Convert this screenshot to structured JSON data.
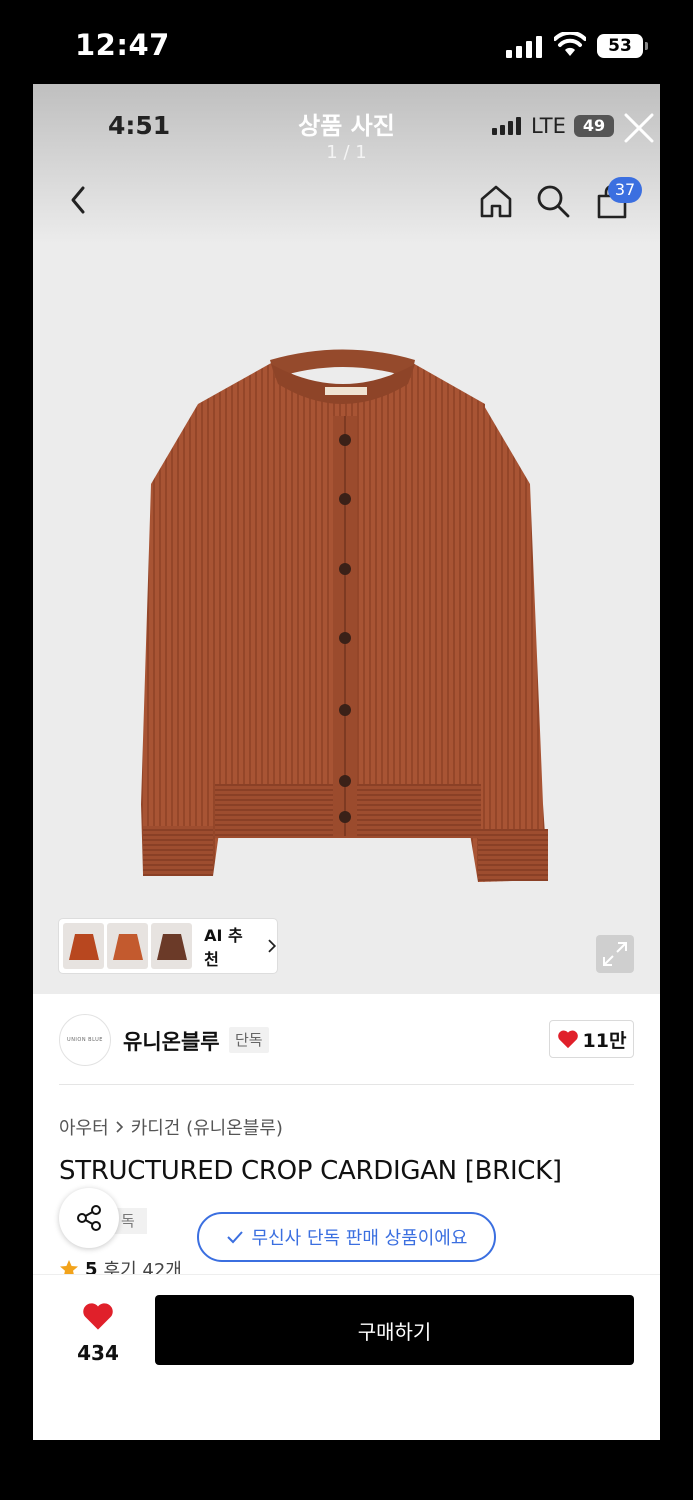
{
  "os_status": {
    "time": "12:47",
    "battery": "53"
  },
  "viewer": {
    "title": "상품 사진",
    "counter": "1 / 1"
  },
  "inner_status": {
    "time": "4:51",
    "network": "LTE",
    "battery": "49"
  },
  "nav": {
    "cart_count": "37"
  },
  "ai_recommend": {
    "label": "AI 추천"
  },
  "brand": {
    "logo_text": "UNION BLUE",
    "name": "유니온블루",
    "exclusive_tag": "단독",
    "like_count": "11만"
  },
  "breadcrumb": {
    "category": "아우터",
    "subcategory": "카디건 (유니온블루)"
  },
  "product": {
    "title": "STRUCTURED CROP CARDIGAN [BRICK]",
    "tag_partial": "독"
  },
  "exclusive_notice": "무신사 단독 판매 상품이에요",
  "rating": {
    "score": "5",
    "reviews": "후기 42개"
  },
  "bottom_bar": {
    "wish_count": "434",
    "buy_label": "구매하기"
  },
  "colors": {
    "accent_blue": "#3b6fe0",
    "heart_red": "#e0202a",
    "sweater": "#a85434"
  }
}
